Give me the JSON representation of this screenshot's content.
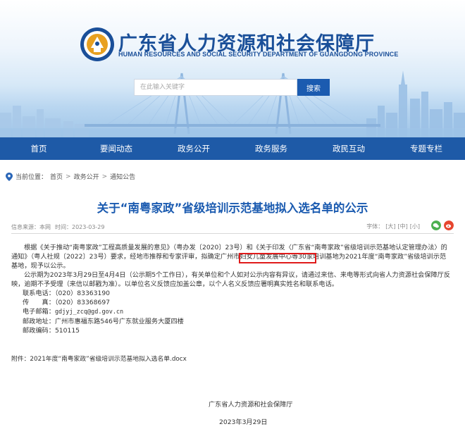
{
  "header": {
    "title": "广东省人力资源和社会保障厅",
    "subtitle": "HUMAN RESOURCES AND SOCIAL SECURITY DEPARTMENT OF GUANGDONG PROVINCE",
    "emblem_icon": "guangdong-hrss-emblem",
    "search": {
      "placeholder": "在此输入关键字",
      "button_label": "搜索"
    }
  },
  "nav": {
    "items": [
      {
        "label": "首页"
      },
      {
        "label": "要闻动态"
      },
      {
        "label": "政务公开"
      },
      {
        "label": "政务服务"
      },
      {
        "label": "政民互动"
      },
      {
        "label": "专题专栏"
      }
    ],
    "background": "#1e5aa7"
  },
  "breadcrumb": {
    "prefix": "当前位置：",
    "items": [
      "首页",
      "政务公开",
      "通知公告"
    ],
    "separator": ">"
  },
  "article": {
    "title": "关于“南粤家政”省级培训示范基地拟入选名单的公示",
    "meta": {
      "source": "信息来源：本网",
      "date": "时间：2023-03-29"
    },
    "font_size": {
      "label": "字体：",
      "large": "[大]",
      "medium": "[中]",
      "small": "[小]"
    },
    "paragraphs": [
      "根据《关于推动“南粤家政”工程高质量发展的意见》（粤办发〔2020〕23号）和《关于印发〈广东省“南粤家政”省级培训示范基地认定管理办法〉的通知》（粤人社规〔2022〕23号）要求，经地市推荐和专家评审，拟确定广州市妇女儿童发展中心等30家培训基地为2021年度“南粤家政”省级培训示范基地，现予以公示。",
      "公示期为2023年3月29日至4月4日（公示期5个工作日），有关单位和个人如对公示内容有异议，请通过来信、来电等形式向省人力资源社会保障厅反映，逾期不予受理（来信以邮戳为准）。以单位名义反馈应加盖公章，以个人名义反馈应署明真实姓名和联系电话。"
    ],
    "highlighted_text": "广州市妇女儿童发展中心",
    "contacts": [
      {
        "label": "联系电话：",
        "value": "（020）83363190"
      },
      {
        "label": "传　　真：",
        "value": "（020）83368697"
      },
      {
        "label": "电子邮箱：",
        "value": "gdjyj_zcq@gd.gov.cn"
      },
      {
        "label": "邮政地址：",
        "value": "广州市惠福东路546号广东就业服务大厦四楼"
      },
      {
        "label": "邮政编码：",
        "value": "510115"
      }
    ],
    "attachment": {
      "label": "附件：",
      "file": "2021年度“南粤家政”省级培训示范基地拟入选名单.docx"
    },
    "signature": "广东省人力资源和社会保障厅",
    "sign_date": "2023年3月29日"
  },
  "colors": {
    "brand_blue": "#1b5bb0",
    "highlight_border": "#e01b1b"
  }
}
